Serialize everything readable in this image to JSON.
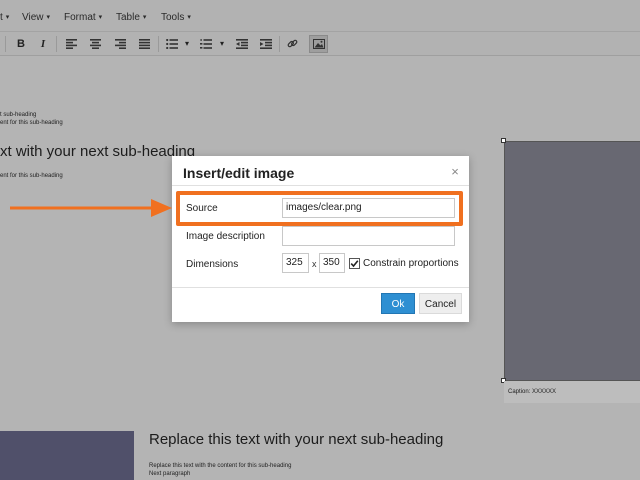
{
  "menubar": {
    "items": [
      {
        "label": "t",
        "caret": "▾"
      },
      {
        "label": "View",
        "caret": "▾"
      },
      {
        "label": "Format",
        "caret": "▾"
      },
      {
        "label": "Table",
        "caret": "▾"
      },
      {
        "label": "Tools",
        "caret": "▾"
      }
    ]
  },
  "toolbar": {
    "bold": "B",
    "italic": "I",
    "dropdown_caret": "▾"
  },
  "document": {
    "top_line1": "t sub-heading",
    "top_line2": "ent for this sub-heading",
    "heading1": "xt with your next sub-heading",
    "heading1_body": "ent for this sub-heading",
    "caption": "Caption: XXXXXX",
    "heading2": "Replace this text with your next sub-heading",
    "heading2_body1": "Replace this text with the content for this sub-heading",
    "heading2_body2": "Next paragraph"
  },
  "dialog": {
    "title": "Insert/edit image",
    "close": "×",
    "source_label": "Source",
    "source_value": "images/clear.png",
    "description_label": "Image description",
    "description_value": "",
    "dimensions_label": "Dimensions",
    "width_value": "325",
    "x_separator": "x",
    "height_value": "350",
    "constrain_label": "Constrain proportions",
    "constrain_checked": true,
    "ok_label": "Ok",
    "cancel_label": "Cancel"
  },
  "colors": {
    "annotation": "#f07020",
    "ok_button": "#2e8fd2"
  }
}
